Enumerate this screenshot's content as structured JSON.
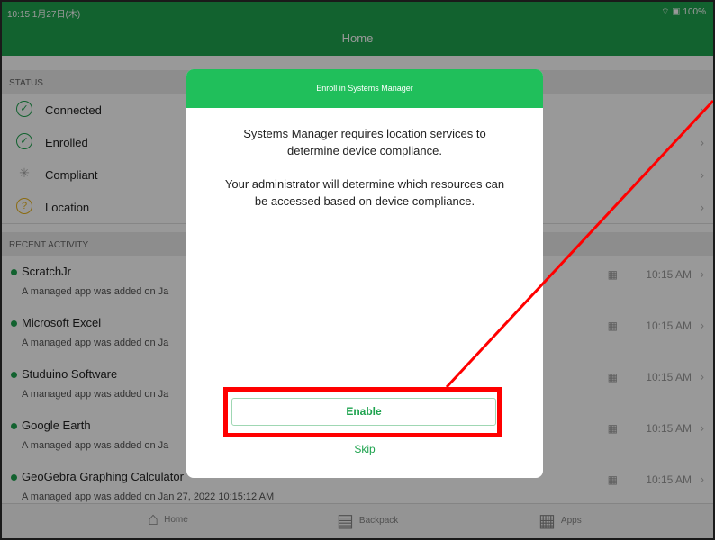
{
  "statusbar": {
    "time": "10:15  1月27日(木)",
    "right": "⌔ ▣ 100%"
  },
  "navbar": {
    "title": "Home"
  },
  "status_section": {
    "heading": "STATUS",
    "rows": [
      {
        "label": "Connected",
        "icon": "check-circle-icon"
      },
      {
        "label": "Enrolled",
        "icon": "check-circle-icon"
      },
      {
        "label": "Compliant",
        "icon": "spinner-icon"
      },
      {
        "label": "Location",
        "icon": "question-circle-icon"
      }
    ]
  },
  "activity_section": {
    "heading": "RECENT ACTIVITY",
    "items": [
      {
        "name": "ScratchJr",
        "desc": "A managed app was added on Ja",
        "time": "10:15 AM"
      },
      {
        "name": "Microsoft Excel",
        "desc": "A managed app was added on Ja",
        "time": "10:15 AM"
      },
      {
        "name": "Studuino Software",
        "desc": "A managed app was added on Ja",
        "time": "10:15 AM"
      },
      {
        "name": "Google Earth",
        "desc": "A managed app was added on Ja",
        "time": "10:15 AM"
      },
      {
        "name": "GeoGebra Graphing Calculator",
        "desc": "A managed app was added on Jan 27, 2022 10:15:12 AM",
        "time": "10:15 AM"
      }
    ]
  },
  "tabbar": {
    "home": "Home",
    "backpack": "Backpack",
    "apps": "Apps"
  },
  "modal": {
    "title": "Enroll in Systems Manager",
    "para1": "Systems Manager requires location services to determine device compliance.",
    "para2": "Your administrator will determine which resources can be accessed based on device compliance.",
    "enable_label": "Enable",
    "skip_label": "Skip"
  },
  "colors": {
    "accent": "#1fa34f",
    "modal_header": "#20bf5b",
    "annotation": "#ff0000"
  }
}
